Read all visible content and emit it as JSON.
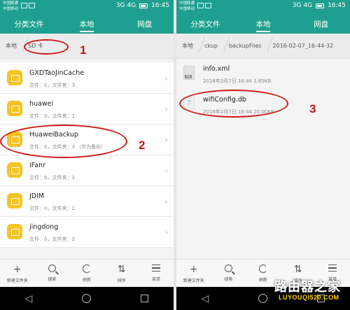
{
  "status_bar": {
    "carrier1": "中国联通",
    "carrier2": "中国移动",
    "network": "3G 4G",
    "time": "16:45"
  },
  "tabs": [
    "分类文件",
    "本地",
    "网盘"
  ],
  "left": {
    "breadcrumb": [
      "本地",
      "SD 卡"
    ],
    "folders": [
      {
        "name": "GXDTaoJinCache",
        "meta": "文件：0，文件夹：3"
      },
      {
        "name": "huawei",
        "meta": "文件：0，文件夹：1"
      },
      {
        "name": "HuaweiBackup",
        "meta": "文件：0，文件夹：3  （华为备份）"
      },
      {
        "name": "iFanr",
        "meta": "文件：0，文件夹：1"
      },
      {
        "name": "JDIM",
        "meta": "文件：0，文件夹：2"
      },
      {
        "name": "jingdong",
        "meta": "文件：0，文件夹：2"
      }
    ],
    "toolbar": [
      "新建文件夹",
      "搜索",
      "刷新",
      "排序",
      "菜单"
    ]
  },
  "right": {
    "breadcrumb": [
      "本地",
      "ckup",
      "backupFiles",
      "2016-02-07_16-44-32"
    ],
    "files": [
      {
        "name": "info.xml",
        "meta": "2016年2月7日 16:44 1.65KB",
        "icon": "xml-file-icon"
      },
      {
        "name": "wifiConfig.db",
        "meta": "2016年2月7日 16:44 20.00KB",
        "icon": "unknown-file-icon"
      }
    ],
    "toolbar": [
      "新建文件夹",
      "搜索",
      "刷新",
      "排序",
      "菜单"
    ]
  },
  "annotations": [
    "1",
    "2",
    "3"
  ],
  "watermark": {
    "title": "路由器之家",
    "url": "LUYOUQI520.COM"
  },
  "colors": {
    "header": "#1f9f8f",
    "folder": "#f5c324",
    "annotation": "#d01818"
  }
}
